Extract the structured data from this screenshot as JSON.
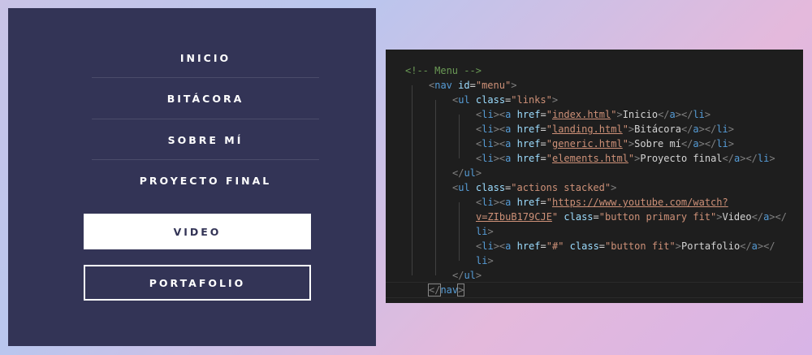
{
  "menu": {
    "links": [
      "INICIO",
      "BITÁCORA",
      "SOBRE MÍ",
      "PROYECTO FINAL"
    ],
    "buttons": {
      "video": "VIDEO",
      "portafolio": "PORTAFOLIO"
    }
  },
  "editor": {
    "lines": [
      [
        [
          "c-comment",
          "<!-- Menu -->"
        ]
      ],
      [
        [
          "c-br",
          "<"
        ],
        [
          "c-tag",
          "nav"
        ],
        [
          "c-eq",
          " "
        ],
        [
          "c-attr",
          "id"
        ],
        [
          "c-eq",
          "="
        ],
        [
          "c-str",
          "\"menu\""
        ],
        [
          "c-br",
          ">"
        ]
      ],
      [
        [
          "c-br",
          "<"
        ],
        [
          "c-tag",
          "ul"
        ],
        [
          "c-eq",
          " "
        ],
        [
          "c-attr",
          "class"
        ],
        [
          "c-eq",
          "="
        ],
        [
          "c-str",
          "\"links\""
        ],
        [
          "c-br",
          ">"
        ]
      ],
      [
        [
          "c-br",
          "<"
        ],
        [
          "c-tag",
          "li"
        ],
        [
          "c-br",
          "><"
        ],
        [
          "c-tag",
          "a"
        ],
        [
          "c-eq",
          " "
        ],
        [
          "c-attr",
          "href"
        ],
        [
          "c-eq",
          "="
        ],
        [
          "c-str",
          "\""
        ],
        [
          "c-link",
          "index.html"
        ],
        [
          "c-str",
          "\""
        ],
        [
          "c-br",
          ">"
        ],
        [
          "c-text",
          "Inicio"
        ],
        [
          "c-br",
          "</"
        ],
        [
          "c-tag",
          "a"
        ],
        [
          "c-br",
          "></"
        ],
        [
          "c-tag",
          "li"
        ],
        [
          "c-br",
          ">"
        ]
      ],
      [
        [
          "c-br",
          "<"
        ],
        [
          "c-tag",
          "li"
        ],
        [
          "c-br",
          "><"
        ],
        [
          "c-tag",
          "a"
        ],
        [
          "c-eq",
          " "
        ],
        [
          "c-attr",
          "href"
        ],
        [
          "c-eq",
          "="
        ],
        [
          "c-str",
          "\""
        ],
        [
          "c-link",
          "landing.html"
        ],
        [
          "c-str",
          "\""
        ],
        [
          "c-br",
          ">"
        ],
        [
          "c-text",
          "Bitácora"
        ],
        [
          "c-br",
          "</"
        ],
        [
          "c-tag",
          "a"
        ],
        [
          "c-br",
          "></"
        ],
        [
          "c-tag",
          "li"
        ],
        [
          "c-br",
          ">"
        ]
      ],
      [
        [
          "c-br",
          "<"
        ],
        [
          "c-tag",
          "li"
        ],
        [
          "c-br",
          "><"
        ],
        [
          "c-tag",
          "a"
        ],
        [
          "c-eq",
          " "
        ],
        [
          "c-attr",
          "href"
        ],
        [
          "c-eq",
          "="
        ],
        [
          "c-str",
          "\""
        ],
        [
          "c-link",
          "generic.html"
        ],
        [
          "c-str",
          "\""
        ],
        [
          "c-br",
          ">"
        ],
        [
          "c-text",
          "Sobre mí"
        ],
        [
          "c-br",
          "</"
        ],
        [
          "c-tag",
          "a"
        ],
        [
          "c-br",
          "></"
        ],
        [
          "c-tag",
          "li"
        ],
        [
          "c-br",
          ">"
        ]
      ],
      [
        [
          "c-br",
          "<"
        ],
        [
          "c-tag",
          "li"
        ],
        [
          "c-br",
          "><"
        ],
        [
          "c-tag",
          "a"
        ],
        [
          "c-eq",
          " "
        ],
        [
          "c-attr",
          "href"
        ],
        [
          "c-eq",
          "="
        ],
        [
          "c-str",
          "\""
        ],
        [
          "c-link",
          "elements.html"
        ],
        [
          "c-str",
          "\""
        ],
        [
          "c-br",
          ">"
        ],
        [
          "c-text",
          "Proyecto final"
        ],
        [
          "c-br",
          "</"
        ],
        [
          "c-tag",
          "a"
        ],
        [
          "c-br",
          "></"
        ],
        [
          "c-tag",
          "li"
        ],
        [
          "c-br",
          ">"
        ]
      ],
      [
        [
          "c-br",
          "</"
        ],
        [
          "c-tag",
          "ul"
        ],
        [
          "c-br",
          ">"
        ]
      ],
      [
        [
          "c-br",
          "<"
        ],
        [
          "c-tag",
          "ul"
        ],
        [
          "c-eq",
          " "
        ],
        [
          "c-attr",
          "class"
        ],
        [
          "c-eq",
          "="
        ],
        [
          "c-str",
          "\"actions stacked\""
        ],
        [
          "c-br",
          ">"
        ]
      ],
      [
        [
          "c-br",
          "<"
        ],
        [
          "c-tag",
          "li"
        ],
        [
          "c-br",
          "><"
        ],
        [
          "c-tag",
          "a"
        ],
        [
          "c-eq",
          " "
        ],
        [
          "c-attr",
          "href"
        ],
        [
          "c-eq",
          "="
        ],
        [
          "c-str",
          "\""
        ],
        [
          "c-link",
          "https://www.youtube.com/watch?"
        ]
      ],
      [
        [
          "c-link",
          "v=ZIbuB179CJE"
        ],
        [
          "c-str",
          "\""
        ],
        [
          "c-eq",
          " "
        ],
        [
          "c-attr",
          "class"
        ],
        [
          "c-eq",
          "="
        ],
        [
          "c-str",
          "\"button primary fit\""
        ],
        [
          "c-br",
          ">"
        ],
        [
          "c-text",
          "Video"
        ],
        [
          "c-br",
          "</"
        ],
        [
          "c-tag",
          "a"
        ],
        [
          "c-br",
          "></"
        ]
      ],
      [
        [
          "c-tag",
          "li"
        ],
        [
          "c-br",
          ">"
        ]
      ],
      [
        [
          "c-br",
          "<"
        ],
        [
          "c-tag",
          "li"
        ],
        [
          "c-br",
          "><"
        ],
        [
          "c-tag",
          "a"
        ],
        [
          "c-eq",
          " "
        ],
        [
          "c-attr",
          "href"
        ],
        [
          "c-eq",
          "="
        ],
        [
          "c-str",
          "\"#\""
        ],
        [
          "c-eq",
          " "
        ],
        [
          "c-attr",
          "class"
        ],
        [
          "c-eq",
          "="
        ],
        [
          "c-str",
          "\"button fit\""
        ],
        [
          "c-br",
          ">"
        ],
        [
          "c-text",
          "Portafolio"
        ],
        [
          "c-br",
          "</"
        ],
        [
          "c-tag",
          "a"
        ],
        [
          "c-br",
          "></"
        ]
      ],
      [
        [
          "c-tag",
          "li"
        ],
        [
          "c-br",
          ">"
        ]
      ],
      [
        [
          "c-br",
          "</"
        ],
        [
          "c-tag",
          "ul"
        ],
        [
          "c-br",
          ">"
        ]
      ],
      [
        [
          "c-br",
          "</"
        ],
        [
          "c-tag",
          "nav"
        ],
        [
          "c-br",
          ">"
        ]
      ]
    ]
  }
}
